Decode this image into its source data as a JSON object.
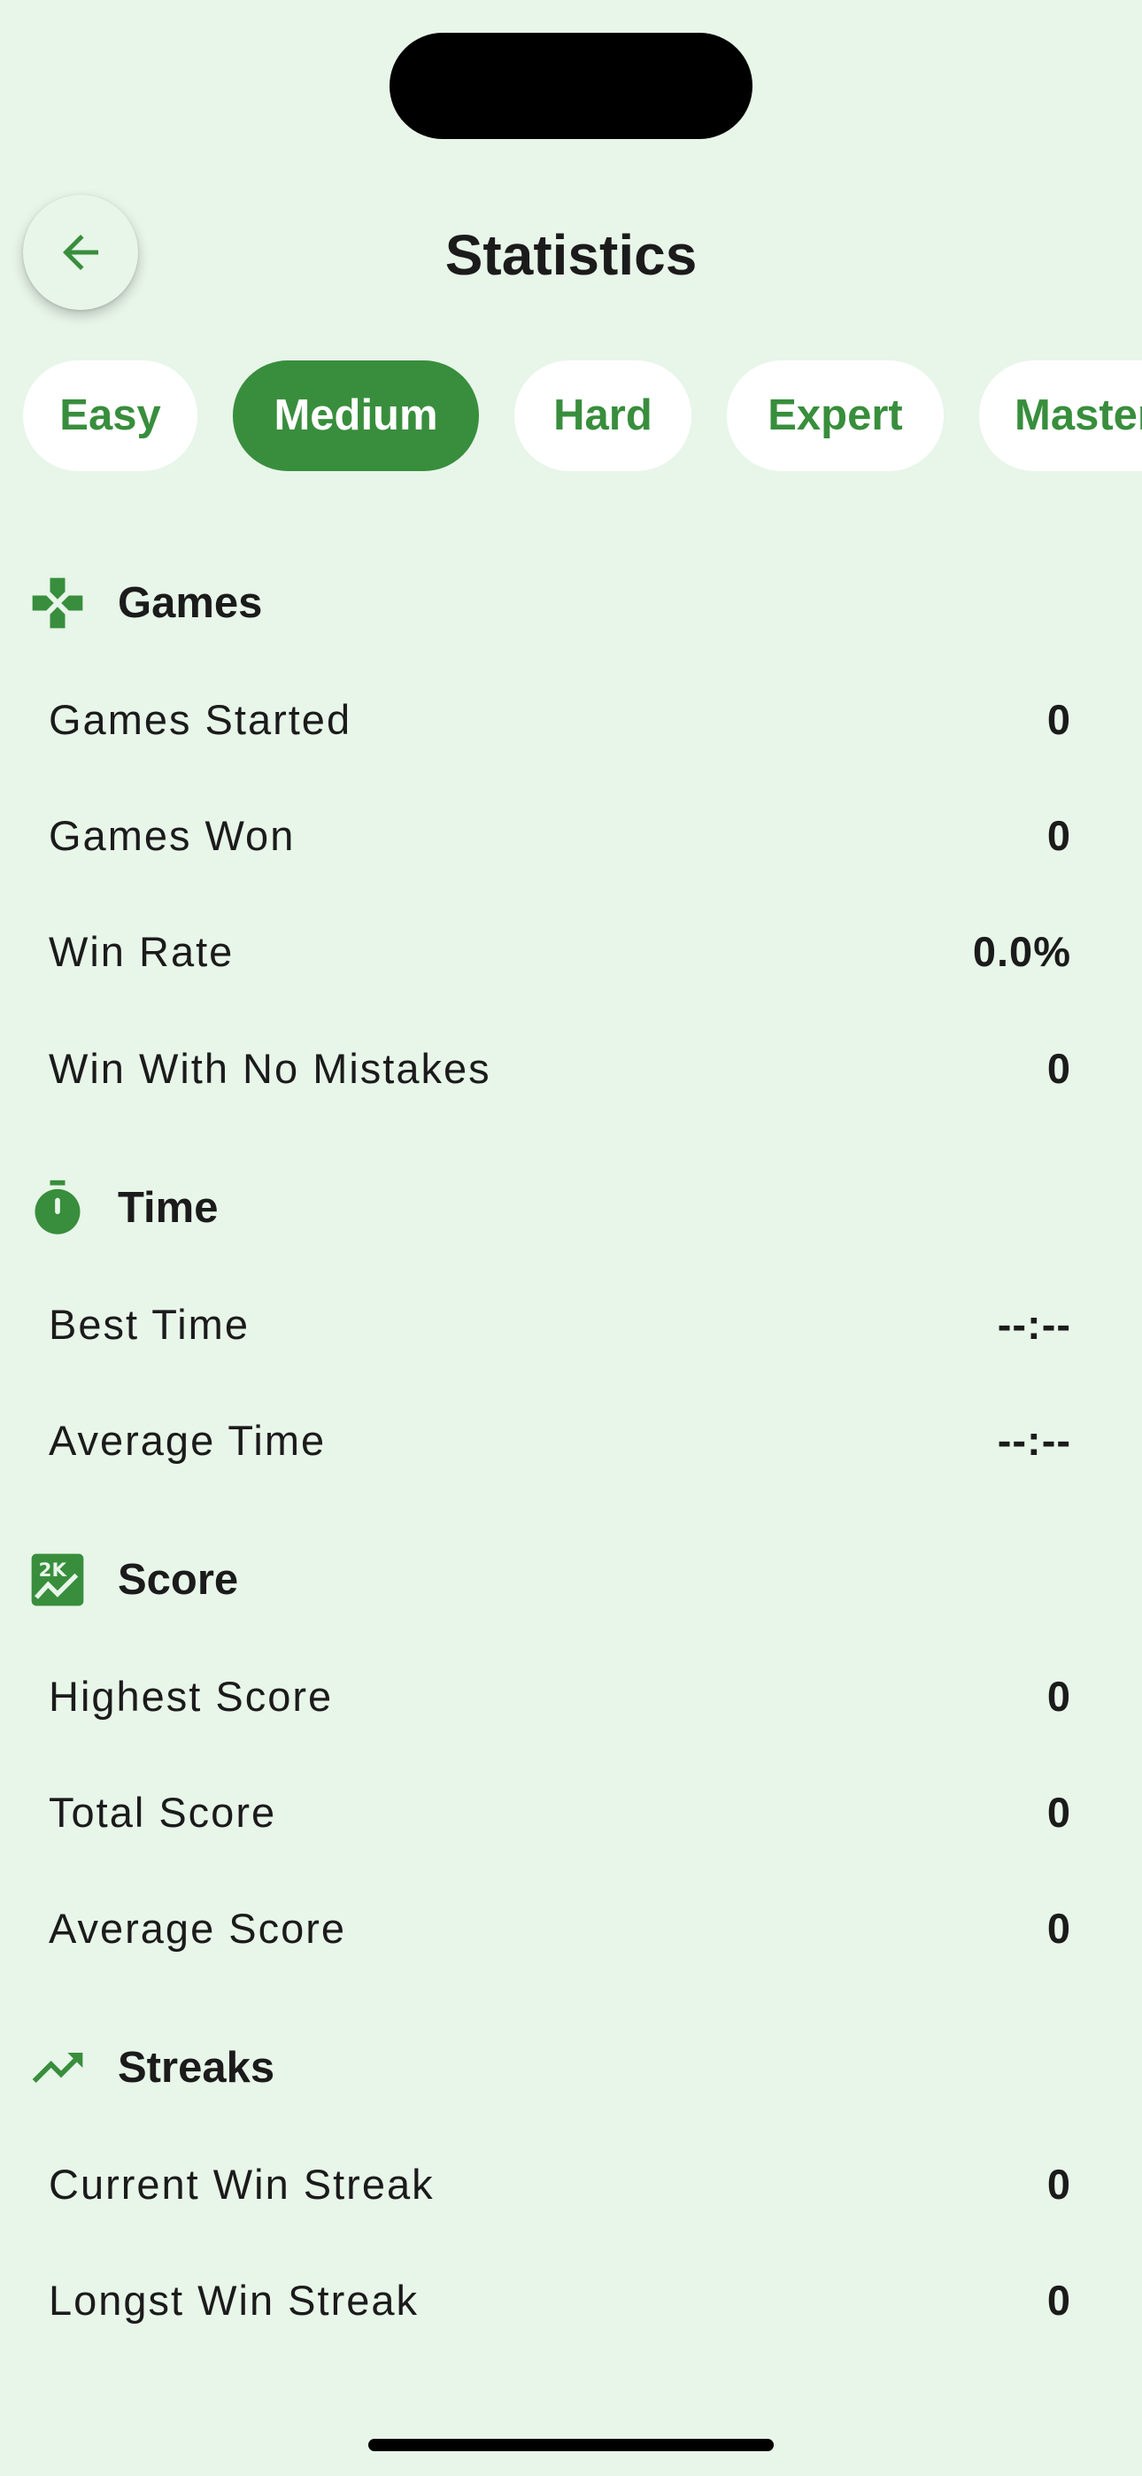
{
  "header": {
    "title": "Statistics",
    "back_icon": "arrow-left-icon"
  },
  "colors": {
    "background": "#e8f5e9",
    "accent": "#388e3c",
    "tab_inactive_bg": "#ffffff",
    "text": "#1b1b1b"
  },
  "tabs": [
    {
      "label": "Easy",
      "active": false
    },
    {
      "label": "Medium",
      "active": true
    },
    {
      "label": "Hard",
      "active": false
    },
    {
      "label": "Expert",
      "active": false
    },
    {
      "label": "Master",
      "active": false
    }
  ],
  "sections": {
    "games": {
      "title": "Games",
      "icon": "gamepad-icon",
      "rows": [
        {
          "label": "Games Started",
          "value": "0"
        },
        {
          "label": "Games Won",
          "value": "0"
        },
        {
          "label": "Win Rate",
          "value": "0.0%"
        },
        {
          "label": "Win With No Mistakes",
          "value": "0"
        }
      ]
    },
    "time": {
      "title": "Time",
      "icon": "stopwatch-icon",
      "rows": [
        {
          "label": "Best Time",
          "value": "--:--"
        },
        {
          "label": "Average Time",
          "value": "--:--"
        }
      ]
    },
    "score": {
      "title": "Score",
      "icon": "score-chart-icon",
      "rows": [
        {
          "label": "Highest Score",
          "value": "0"
        },
        {
          "label": "Total Score",
          "value": "0"
        },
        {
          "label": "Average Score",
          "value": "0"
        }
      ]
    },
    "streaks": {
      "title": "Streaks",
      "icon": "trending-up-icon",
      "rows": [
        {
          "label": "Current Win Streak",
          "value": "0"
        },
        {
          "label": "Longst Win Streak",
          "value": "0"
        }
      ]
    }
  }
}
